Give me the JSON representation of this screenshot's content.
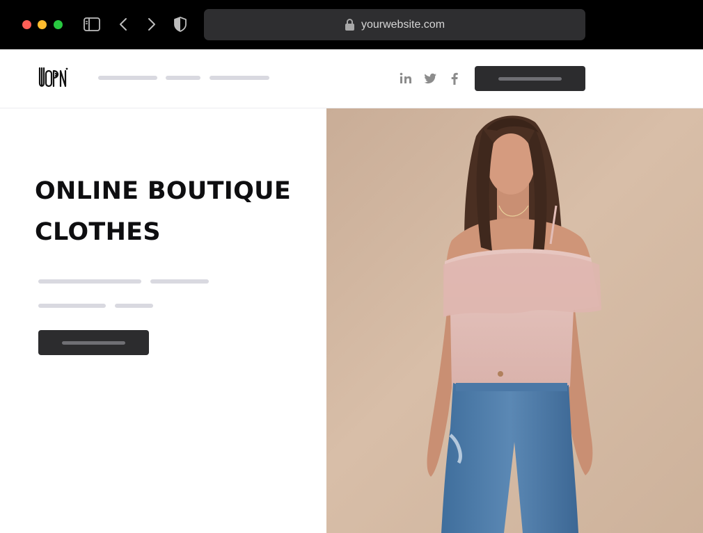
{
  "browser": {
    "url": "yourwebsite.com",
    "traffic_lights": [
      "#ff5f57",
      "#febc2e",
      "#28c840"
    ],
    "icons": [
      "sidebar-icon",
      "back-icon",
      "forward-icon",
      "shield-icon",
      "lock-icon"
    ]
  },
  "header": {
    "logo_text": "LOGO",
    "social_icons": [
      "linkedin-icon",
      "twitter-icon",
      "facebook-icon"
    ]
  },
  "hero": {
    "title_line1": "ONLINE BOUTIQUE",
    "title_line2": "CLOTHES"
  },
  "colors": {
    "chrome": "#000000",
    "url_bar": "#2e2e30",
    "button": "#2c2c2e",
    "placeholder": "#d9d9e0",
    "title": "#0e0e10",
    "photo_bg": "#d2b8a2"
  }
}
